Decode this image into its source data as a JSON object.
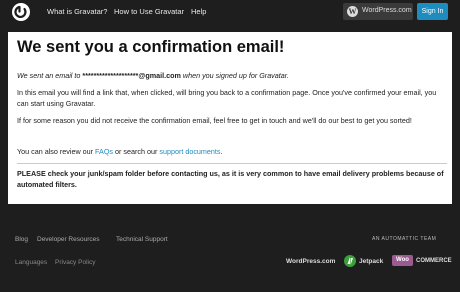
{
  "nav": {
    "links": [
      "What is Gravatar?",
      "How to Use Gravatar",
      "Help"
    ],
    "wordpress_label": "WordPress.com",
    "signin_label": "Sign In"
  },
  "main": {
    "title": "We sent you a confirmation email!",
    "sent_prefix": "We sent an email to ",
    "email": "********************@gmail.com",
    "sent_suffix": " when you signed up for Gravatar.",
    "p2": "In this email you will find a link that, when clicked, will bring you back to a confirmation page. Once you've confirmed your email, you can start using Gravatar.",
    "p3": "If for some reason you did not receive the confirmation email, feel free to get in touch and we'll do our best to get you sorted!",
    "p4_prefix": "You can also review our ",
    "faqs_link": "FAQs",
    "p4_mid": " or search our ",
    "support_link": "support documents",
    "p4_suffix": ".",
    "note": "PLEASE check your junk/spam folder before contacting us, as it is very common to have email delivery problems because of automated filters."
  },
  "footer": {
    "row1": [
      "Blog",
      "Developer Resources",
      "Technical Support"
    ],
    "row2": [
      "Languages",
      "Privacy Policy"
    ],
    "automattic_tag": "AN AUTOMATTIC TEAM",
    "wordpress_brand": "WordPress.com",
    "jetpack_brand": "Jetpack",
    "woo_badge": "Woo",
    "woo_text": "COMMERCE"
  }
}
